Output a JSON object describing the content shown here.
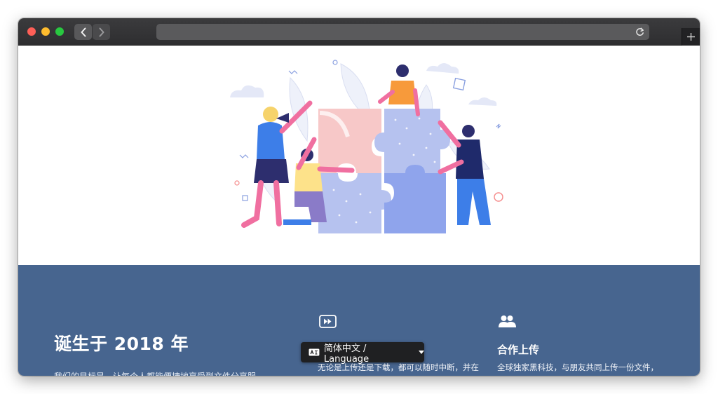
{
  "browser": {
    "back_icon": "chevron-left-icon",
    "forward_icon": "chevron-right-icon",
    "reload_icon": "reload-icon",
    "new_tab_icon": "plus-icon"
  },
  "hero": {
    "illustration": "team-assembling-puzzle-illustration"
  },
  "about": {
    "title": "诞生于 2018 年",
    "subtitle": "我们的目标是，让每个人都能便捷地享受到文件分享服"
  },
  "features": [
    {
      "icon": "fast-forward-icon",
      "title": "",
      "desc": "无论是上传还是下载，都可以随时中断，并在"
    },
    {
      "icon": "users-icon",
      "title": "合作上传",
      "desc": "全球独家黑科技，与朋友共同上传一份文件，"
    }
  ],
  "language_selector": {
    "icon": "language-icon",
    "label": "简体中文 / Language"
  },
  "colors": {
    "band_background": "#47658f",
    "titlebar": "#2e2e30",
    "lang_button": "#1f2022"
  }
}
